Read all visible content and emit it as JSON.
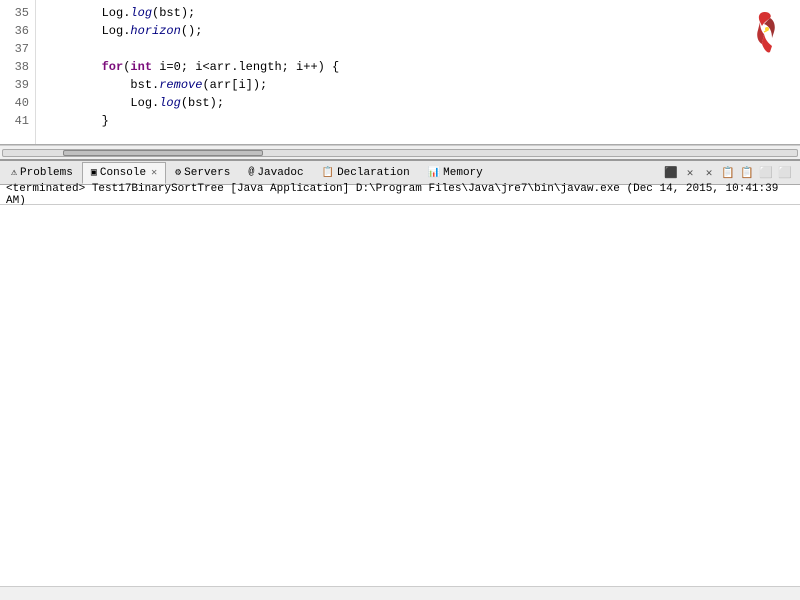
{
  "editor": {
    "lines": [
      {
        "num": "35",
        "code": [
          {
            "type": "plain",
            "text": "        Log."
          },
          {
            "type": "method",
            "text": "log"
          },
          {
            "type": "plain",
            "text": "(bst);"
          }
        ]
      },
      {
        "num": "36",
        "code": [
          {
            "type": "plain",
            "text": "        Log."
          },
          {
            "type": "method",
            "text": "horizon"
          },
          {
            "type": "plain",
            "text": "();"
          }
        ]
      },
      {
        "num": "37",
        "code": [
          {
            "type": "plain",
            "text": ""
          }
        ]
      },
      {
        "num": "38",
        "code": [
          {
            "type": "plain",
            "text": "        "
          },
          {
            "type": "kw",
            "text": "for"
          },
          {
            "type": "plain",
            "text": "("
          },
          {
            "type": "kw",
            "text": "int"
          },
          {
            "type": "plain",
            "text": " i=0; i<arr.length; i++) {"
          }
        ]
      },
      {
        "num": "39",
        "code": [
          {
            "type": "plain",
            "text": "            bst."
          },
          {
            "type": "method",
            "text": "remove"
          },
          {
            "type": "plain",
            "text": "(arr[i]);"
          }
        ]
      },
      {
        "num": "40",
        "code": [
          {
            "type": "plain",
            "text": "            Log."
          },
          {
            "type": "method",
            "text": "log"
          },
          {
            "type": "plain",
            "text": "(bst);"
          }
        ]
      },
      {
        "num": "41",
        "code": [
          {
            "type": "plain",
            "text": "        }"
          }
        ]
      }
    ]
  },
  "tabs": {
    "items": [
      {
        "id": "problems",
        "label": "Problems",
        "icon": "⚠",
        "active": false,
        "closeable": false
      },
      {
        "id": "console",
        "label": "Console",
        "icon": "▣",
        "active": true,
        "closeable": true
      },
      {
        "id": "servers",
        "label": "Servers",
        "icon": "⚙",
        "active": false,
        "closeable": false
      },
      {
        "id": "javadoc",
        "label": "Javadoc",
        "icon": "@",
        "active": false,
        "closeable": false
      },
      {
        "id": "declaration",
        "label": "Declaration",
        "icon": "📋",
        "active": false,
        "closeable": false
      },
      {
        "id": "memory",
        "label": "Memory",
        "icon": "📊",
        "active": false,
        "closeable": false
      }
    ],
    "toolbar_buttons": [
      "⬛",
      "✕",
      "✕",
      "📋",
      "📋",
      "⬜",
      "⬜"
    ]
  },
  "console": {
    "status": "<terminated> Test17BinarySortTree [Java Application] D:\\Program Files\\Java\\jre7\\bin\\javaw.exe (Dec 14, 2015, 10:41:39 AM)"
  }
}
